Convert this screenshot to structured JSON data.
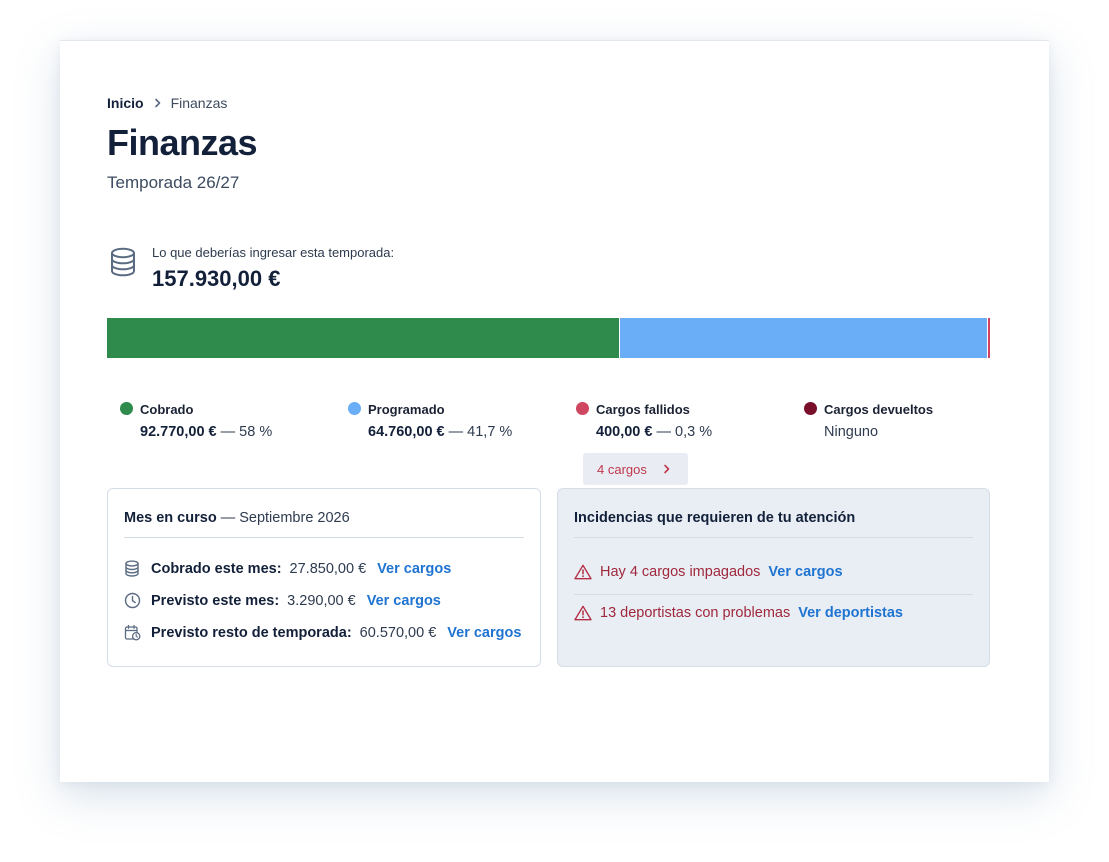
{
  "breadcrumb": {
    "home": "Inicio",
    "current": "Finanzas"
  },
  "page": {
    "title": "Finanzas",
    "subtitle": "Temporada 26/27"
  },
  "expected": {
    "label": "Lo que deberías ingresar esta temporada:",
    "value": "157.930,00 €"
  },
  "progress": {
    "segments": [
      {
        "name": "Cobrado",
        "fraction": 0.58,
        "color": "#2e8b4b"
      },
      {
        "name": "Programado",
        "fraction": 0.417,
        "color": "#6aaef8"
      },
      {
        "name": "Cargos fallidos",
        "fraction": 0.003,
        "color": "#d04060"
      }
    ]
  },
  "legend": {
    "cobrado": {
      "name": "Cobrado",
      "amount": "92.770,00 €",
      "pct": " — 58 %",
      "color": "#2e8b4b"
    },
    "programado": {
      "name": "Programado",
      "amount": "64.760,00 €",
      "pct": " — 41,7 %",
      "color": "#6aaef8"
    },
    "fallidos": {
      "name": "Cargos fallidos",
      "amount": "400,00 €",
      "pct": " — 0,3 %",
      "color": "#cf4660",
      "button": "4 cargos"
    },
    "devueltos": {
      "name": "Cargos devueltos",
      "value": "Ninguno",
      "color": "#7a0f2c"
    }
  },
  "month": {
    "title_bold": "Mes en curso",
    "title_rest": " — Septiembre 2026",
    "rows": [
      {
        "icon": "database-icon",
        "label": "Cobrado este mes:",
        "value": "27.850,00 €",
        "link": "Ver cargos"
      },
      {
        "icon": "clock-icon",
        "label": "Previsto este mes:",
        "value": "3.290,00 €",
        "link": "Ver cargos"
      },
      {
        "icon": "calendar-clock-icon",
        "label": "Previsto resto de temporada:",
        "value": "60.570,00 €",
        "link": "Ver cargos"
      }
    ]
  },
  "incidents": {
    "title": "Incidencias que requieren de tu atención",
    "rows": [
      {
        "icon": "warning-icon",
        "text": "Hay 4 cargos impagados",
        "link": "Ver cargos"
      },
      {
        "icon": "warning-icon",
        "text": "13 deportistas con problemas",
        "link": "Ver deportistas"
      }
    ]
  }
}
